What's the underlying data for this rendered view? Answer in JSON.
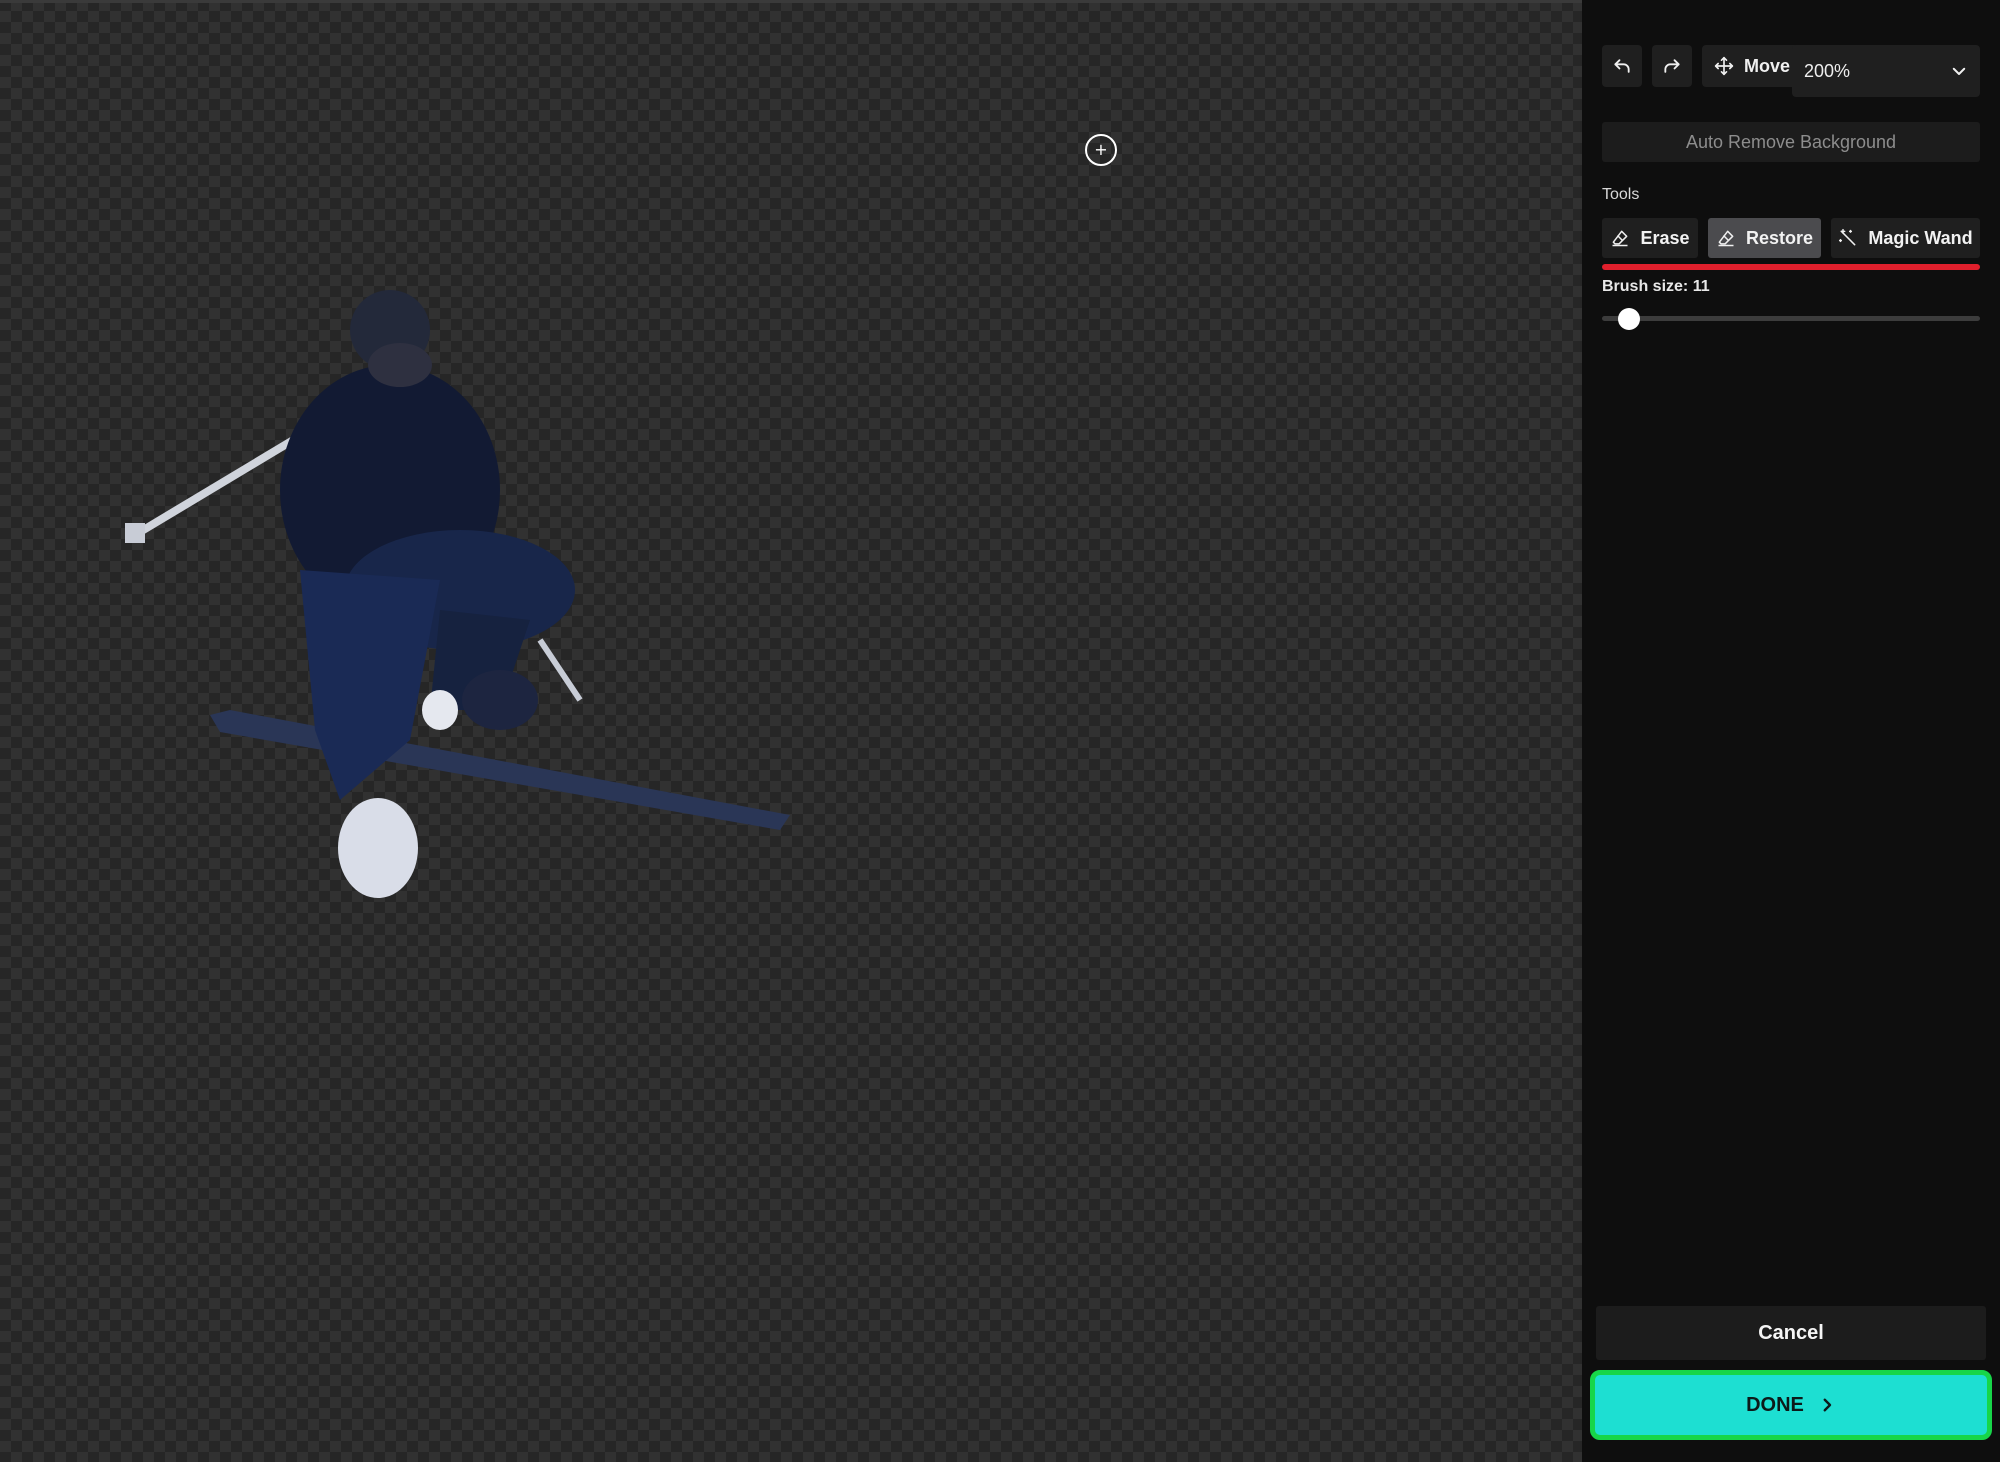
{
  "canvas": {
    "brush_cursor_glyph": "+"
  },
  "toolbar": {
    "undo_icon": "undo-icon",
    "redo_icon": "redo-icon",
    "move_label": "Move",
    "zoom_value": "200%"
  },
  "panel": {
    "auto_remove_label": "Auto Remove Background",
    "tools_heading": "Tools",
    "tools": [
      {
        "label": "Erase",
        "icon": "eraser-icon",
        "active": false
      },
      {
        "label": "Restore",
        "icon": "eraser-icon",
        "active": true
      },
      {
        "label": "Magic Wand",
        "icon": "magic-wand-icon",
        "active": false
      }
    ],
    "brush_size_label": "Brush size: 11",
    "brush_size_value": 11
  },
  "footer": {
    "cancel_label": "Cancel",
    "done_label": "DONE"
  },
  "colors": {
    "done_bg": "#1ddfd2",
    "done_border": "#17d649",
    "highlight_bar": "#e01f2c",
    "active_tool_bg": "#4b4b4e"
  }
}
